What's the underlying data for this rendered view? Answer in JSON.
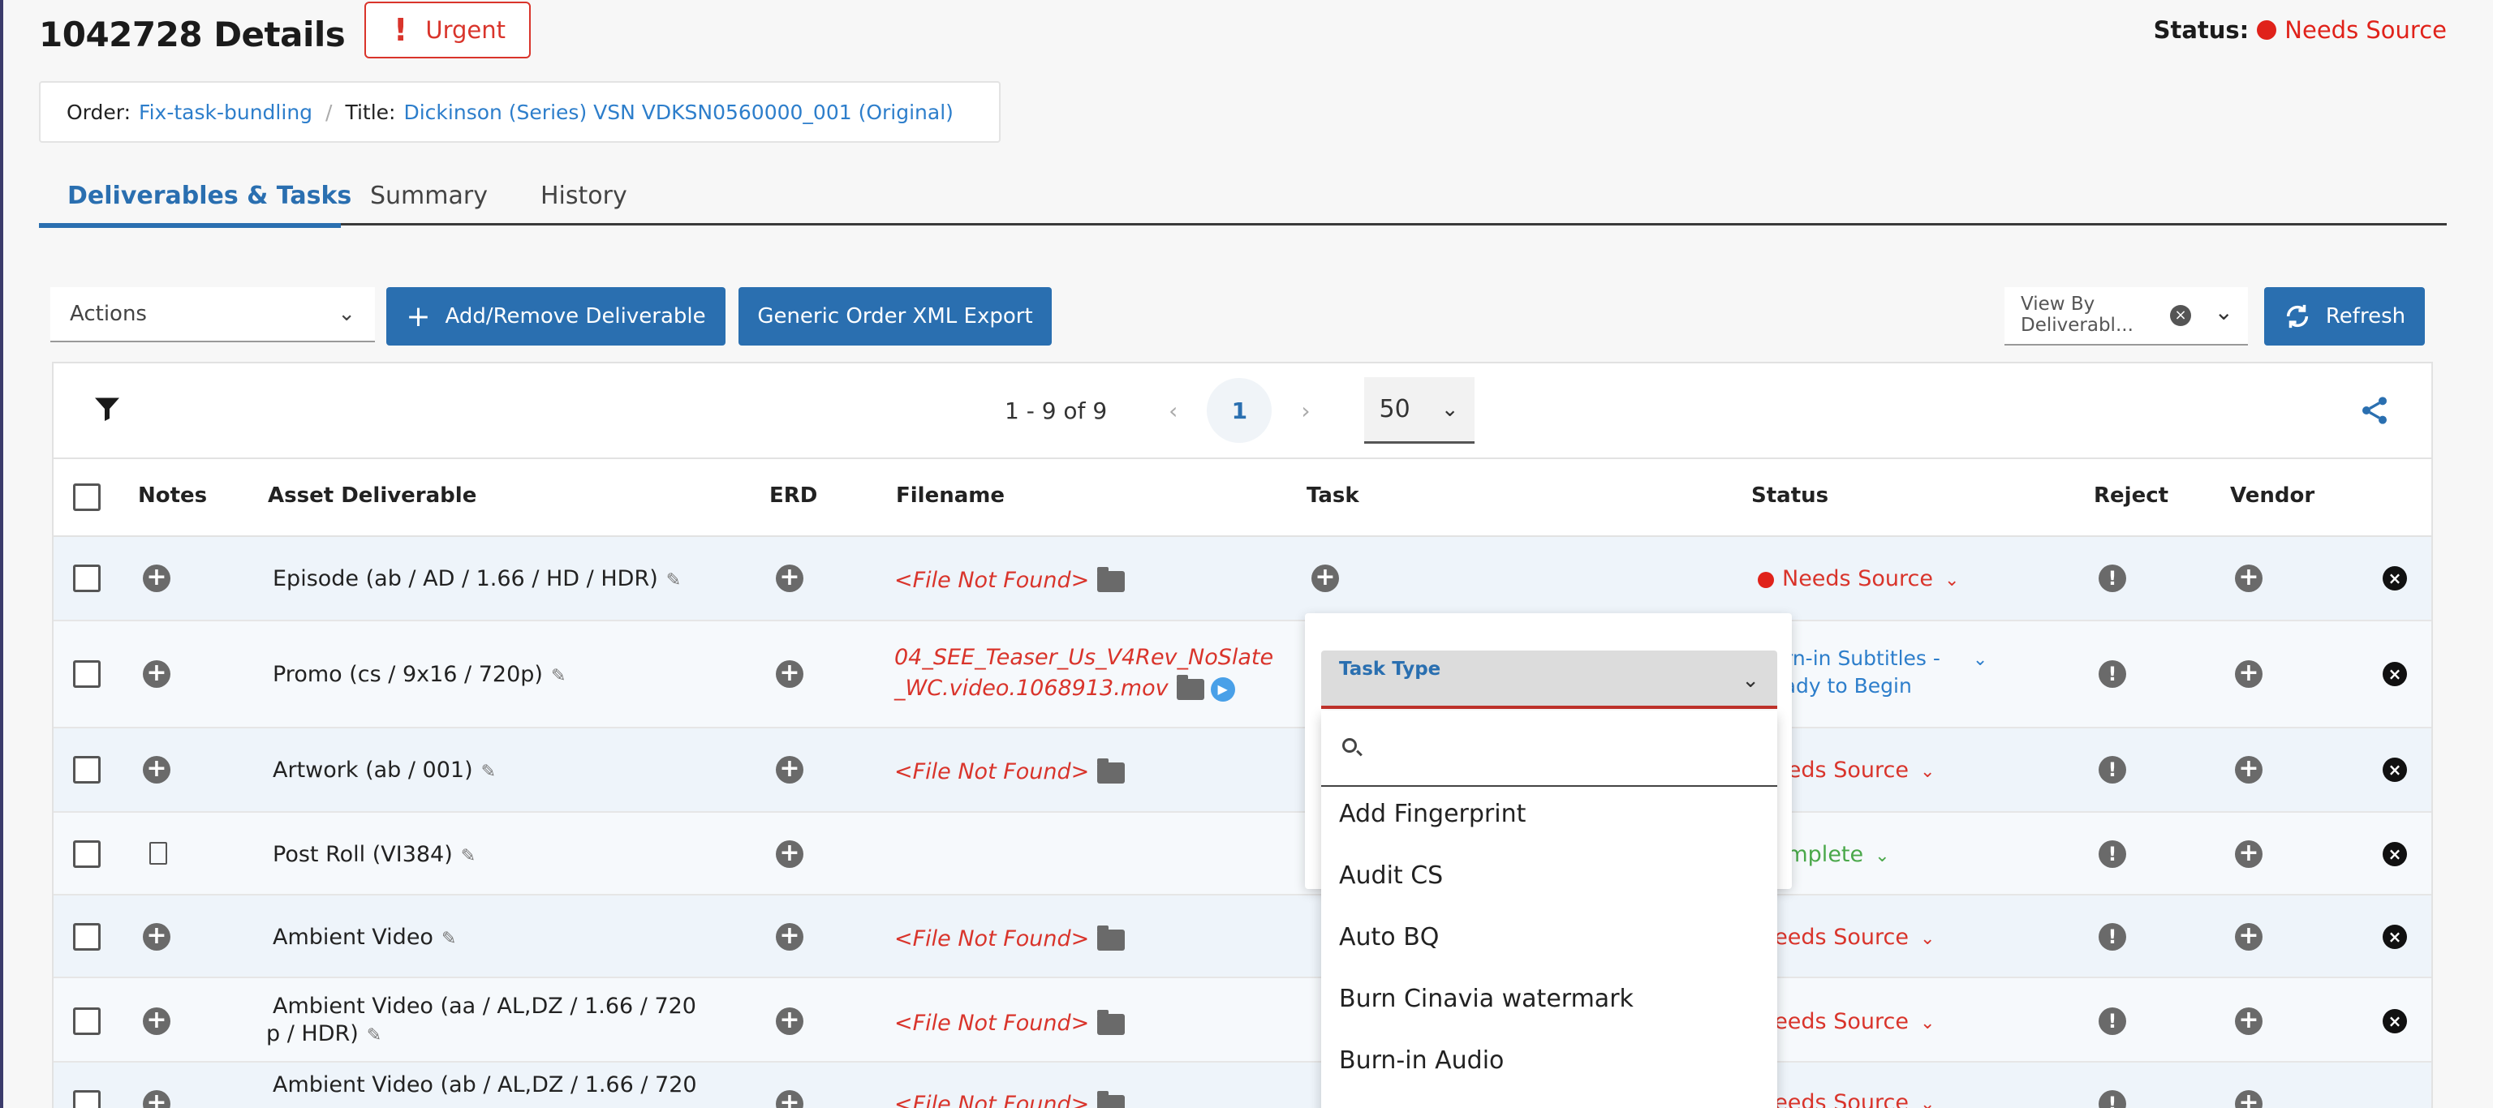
{
  "header": {
    "title": "1042728 Details",
    "badge": "Urgent",
    "status_label": "Status:",
    "status_value": "Needs Source"
  },
  "info": {
    "order_label": "Order:",
    "order_value": "Fix-task-bundling",
    "title_label": "Title:",
    "title_value": "Dickinson (Series) VSN VDKSN0560000_001 (Original)"
  },
  "tabs": [
    {
      "label": "Deliverables & Tasks",
      "active": true
    },
    {
      "label": "Summary",
      "active": false
    },
    {
      "label": "History",
      "active": false
    }
  ],
  "toolbar": {
    "actions_placeholder": "Actions",
    "add_remove_label": "Add/Remove Deliverable",
    "export_label": "Generic Order XML Export",
    "view_by_line1": "View By",
    "view_by_line2": "Deliverabl...",
    "refresh_label": "Refresh"
  },
  "pager": {
    "range": "1 - 9 of 9",
    "current_page": "1",
    "per_page": "50"
  },
  "columns": [
    "Notes",
    "Asset Deliverable",
    "ERD",
    "Filename",
    "Task",
    "Status",
    "Reject",
    "Vendor"
  ],
  "rows": [
    {
      "asset": "Episode (ab / AD / 1.66 / HD / HDR)",
      "filename": "<File Not Found>",
      "status": "Needs Source"
    },
    {
      "asset": "Promo (cs / 9x16 / 720p)",
      "filename_line1": "04_SEE_Teaser_Us_V4Rev_NoSlate",
      "filename_line2": "_WC.video.1068913.mov",
      "status_line1": "Burn-in Subtitles -",
      "status_line2": "Ready to Begin"
    },
    {
      "asset": "Artwork (ab / 001)",
      "filename": "<File Not Found>",
      "status": "Needs Source"
    },
    {
      "asset": "Post Roll (VI384)",
      "filename": "",
      "status": "Complete"
    },
    {
      "asset": "Ambient Video",
      "filename": "<File Not Found>",
      "status": "Needs Source"
    },
    {
      "asset_line1": "Ambient Video (aa / AL,DZ / 1.66 / 720",
      "asset_line2": "p / HDR)",
      "filename": "<File Not Found>",
      "status": "Needs Source"
    },
    {
      "asset": "Ambient Video (ab / AL,DZ / 1.66 / 720",
      "filename": "<File Not Found>",
      "status": "Needs Source"
    }
  ],
  "task_dropdown": {
    "label": "Task Type",
    "search_placeholder": "",
    "options": [
      "Add Fingerprint",
      "Audit CS",
      "Auto BQ",
      "Burn Cinavia watermark",
      "Burn-in Audio"
    ]
  },
  "colors": {
    "primary": "#2a6fb0",
    "danger": "#d9342b",
    "success": "#4aa84a",
    "link": "#2d7ecb"
  }
}
